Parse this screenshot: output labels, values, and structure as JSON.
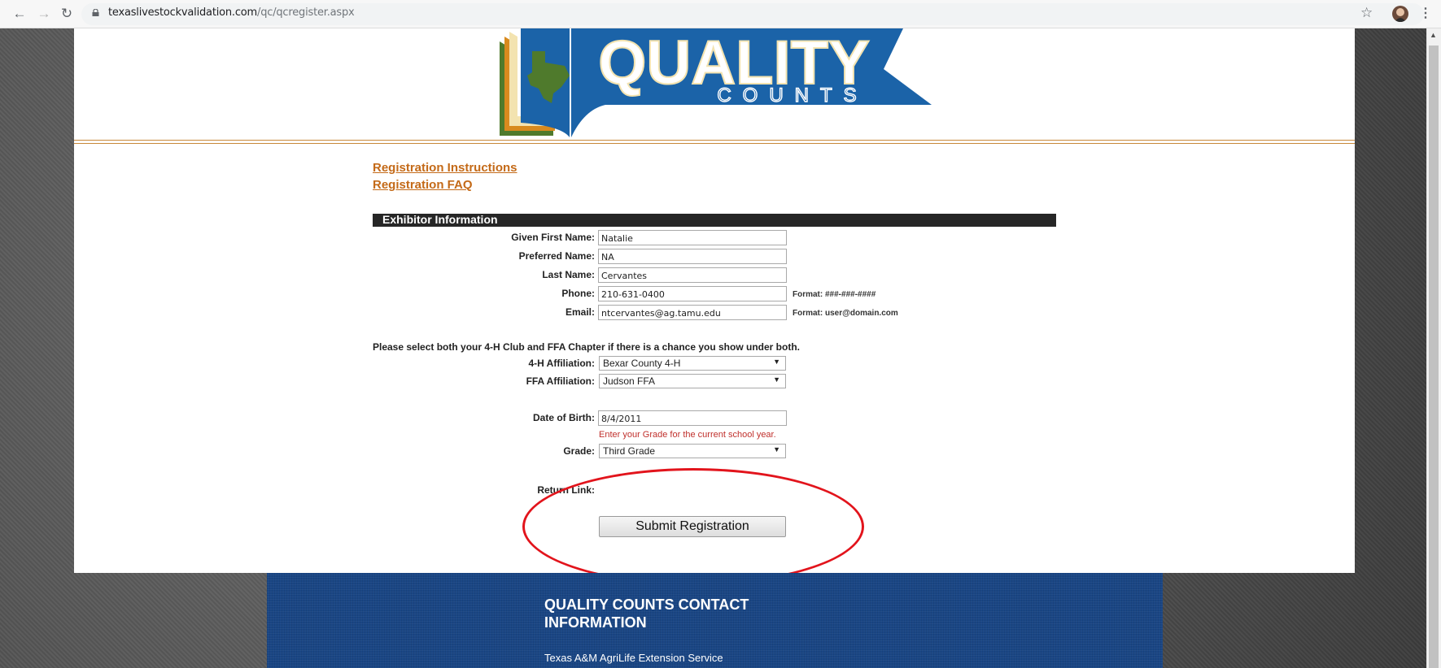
{
  "browser": {
    "url_host": "texaslivestockvalidation.com",
    "url_path": "/qc/qcregister.aspx"
  },
  "logo": {
    "word1": "QUALITY",
    "word2": "COUNTS",
    "colors": {
      "blue": "#1b63a8",
      "green": "#4f7a2c",
      "orange": "#d88a1e",
      "cream": "#f3e3b0"
    }
  },
  "links": {
    "instructions": "Registration Instructions",
    "faq": "Registration FAQ"
  },
  "section": {
    "title": "Exhibitor Information"
  },
  "form": {
    "given_first_name": {
      "label": "Given First Name:",
      "value": "Natalie"
    },
    "preferred_name": {
      "label": "Preferred Name:",
      "value": "NA"
    },
    "last_name": {
      "label": "Last Name:",
      "value": "Cervantes"
    },
    "phone": {
      "label": "Phone:",
      "value": "210-631-0400",
      "format": "Format: ###-###-####"
    },
    "email": {
      "label": "Email:",
      "value": "ntcervantes@ag.tamu.edu",
      "format": "Format: user@domain.com"
    },
    "affiliation_note": "Please select both your 4-H Club and FFA Chapter if there is a chance you show under both.",
    "h4_affiliation": {
      "label": "4-H Affiliation:",
      "value": "Bexar County 4-H"
    },
    "ffa_affiliation": {
      "label": "FFA Affiliation:",
      "value": "Judson FFA"
    },
    "dob": {
      "label": "Date of Birth:",
      "value": "8/4/2011"
    },
    "grade_note": "Enter your Grade for the current school year.",
    "grade": {
      "label": "Grade:",
      "value": "Third Grade"
    },
    "return_link": {
      "label": "Return Link:"
    },
    "submit_label": "Submit Registration"
  },
  "annotation": {
    "color": "#e2141c"
  },
  "footer": {
    "title": "QUALITY COUNTS CONTACT INFORMATION",
    "org": "Texas A&M AgriLife Extension Service"
  }
}
